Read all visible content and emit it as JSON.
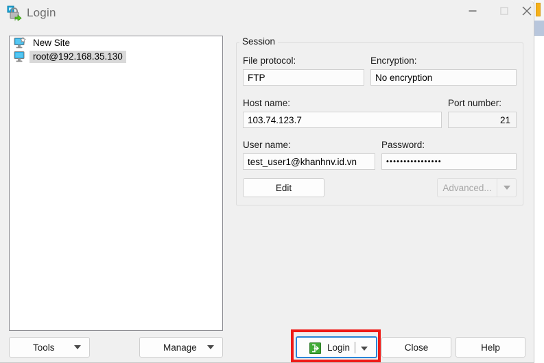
{
  "window": {
    "title": "Login",
    "app_icon": "winscp-login-lock-icon",
    "controls": {
      "minimize": "minimize-icon",
      "maximize": "maximize-icon",
      "close": "close-icon"
    }
  },
  "sites": {
    "items": [
      {
        "label": "New Site",
        "icon": "new-site-monitor-star-icon",
        "selected": false
      },
      {
        "label": "root@192.168.35.130",
        "icon": "site-monitor-icon",
        "selected": true
      }
    ]
  },
  "session": {
    "legend": "Session",
    "file_protocol": {
      "label": "File protocol:",
      "value": "FTP"
    },
    "encryption": {
      "label": "Encryption:",
      "value": "No encryption"
    },
    "host_name": {
      "label": "Host name:",
      "value": "103.74.123.7"
    },
    "port_number": {
      "label": "Port number:",
      "value": "21"
    },
    "user_name": {
      "label": "User name:",
      "value": "test_user1@khanhnv.id.vn"
    },
    "password": {
      "label": "Password:",
      "value": "••••••••••••••••"
    },
    "edit_button": "Edit",
    "advanced_button": "Advanced...",
    "advanced_enabled": false
  },
  "footer": {
    "tools": "Tools",
    "manage": "Manage",
    "login": "Login",
    "login_icon": "login-green-arrow-icon",
    "close": "Close",
    "help": "Help"
  },
  "annotation": {
    "type": "rectangle-highlight",
    "target": "login-button",
    "color": "#ee1b17"
  },
  "colors": {
    "dialog_bg": "#f0f0f0",
    "field_bg": "#fcfcfc",
    "selection": "#d9d9d9",
    "focus_ring": "#2a86d8",
    "accent_green": "#3faa35",
    "annotation_red": "#ee1b17"
  }
}
